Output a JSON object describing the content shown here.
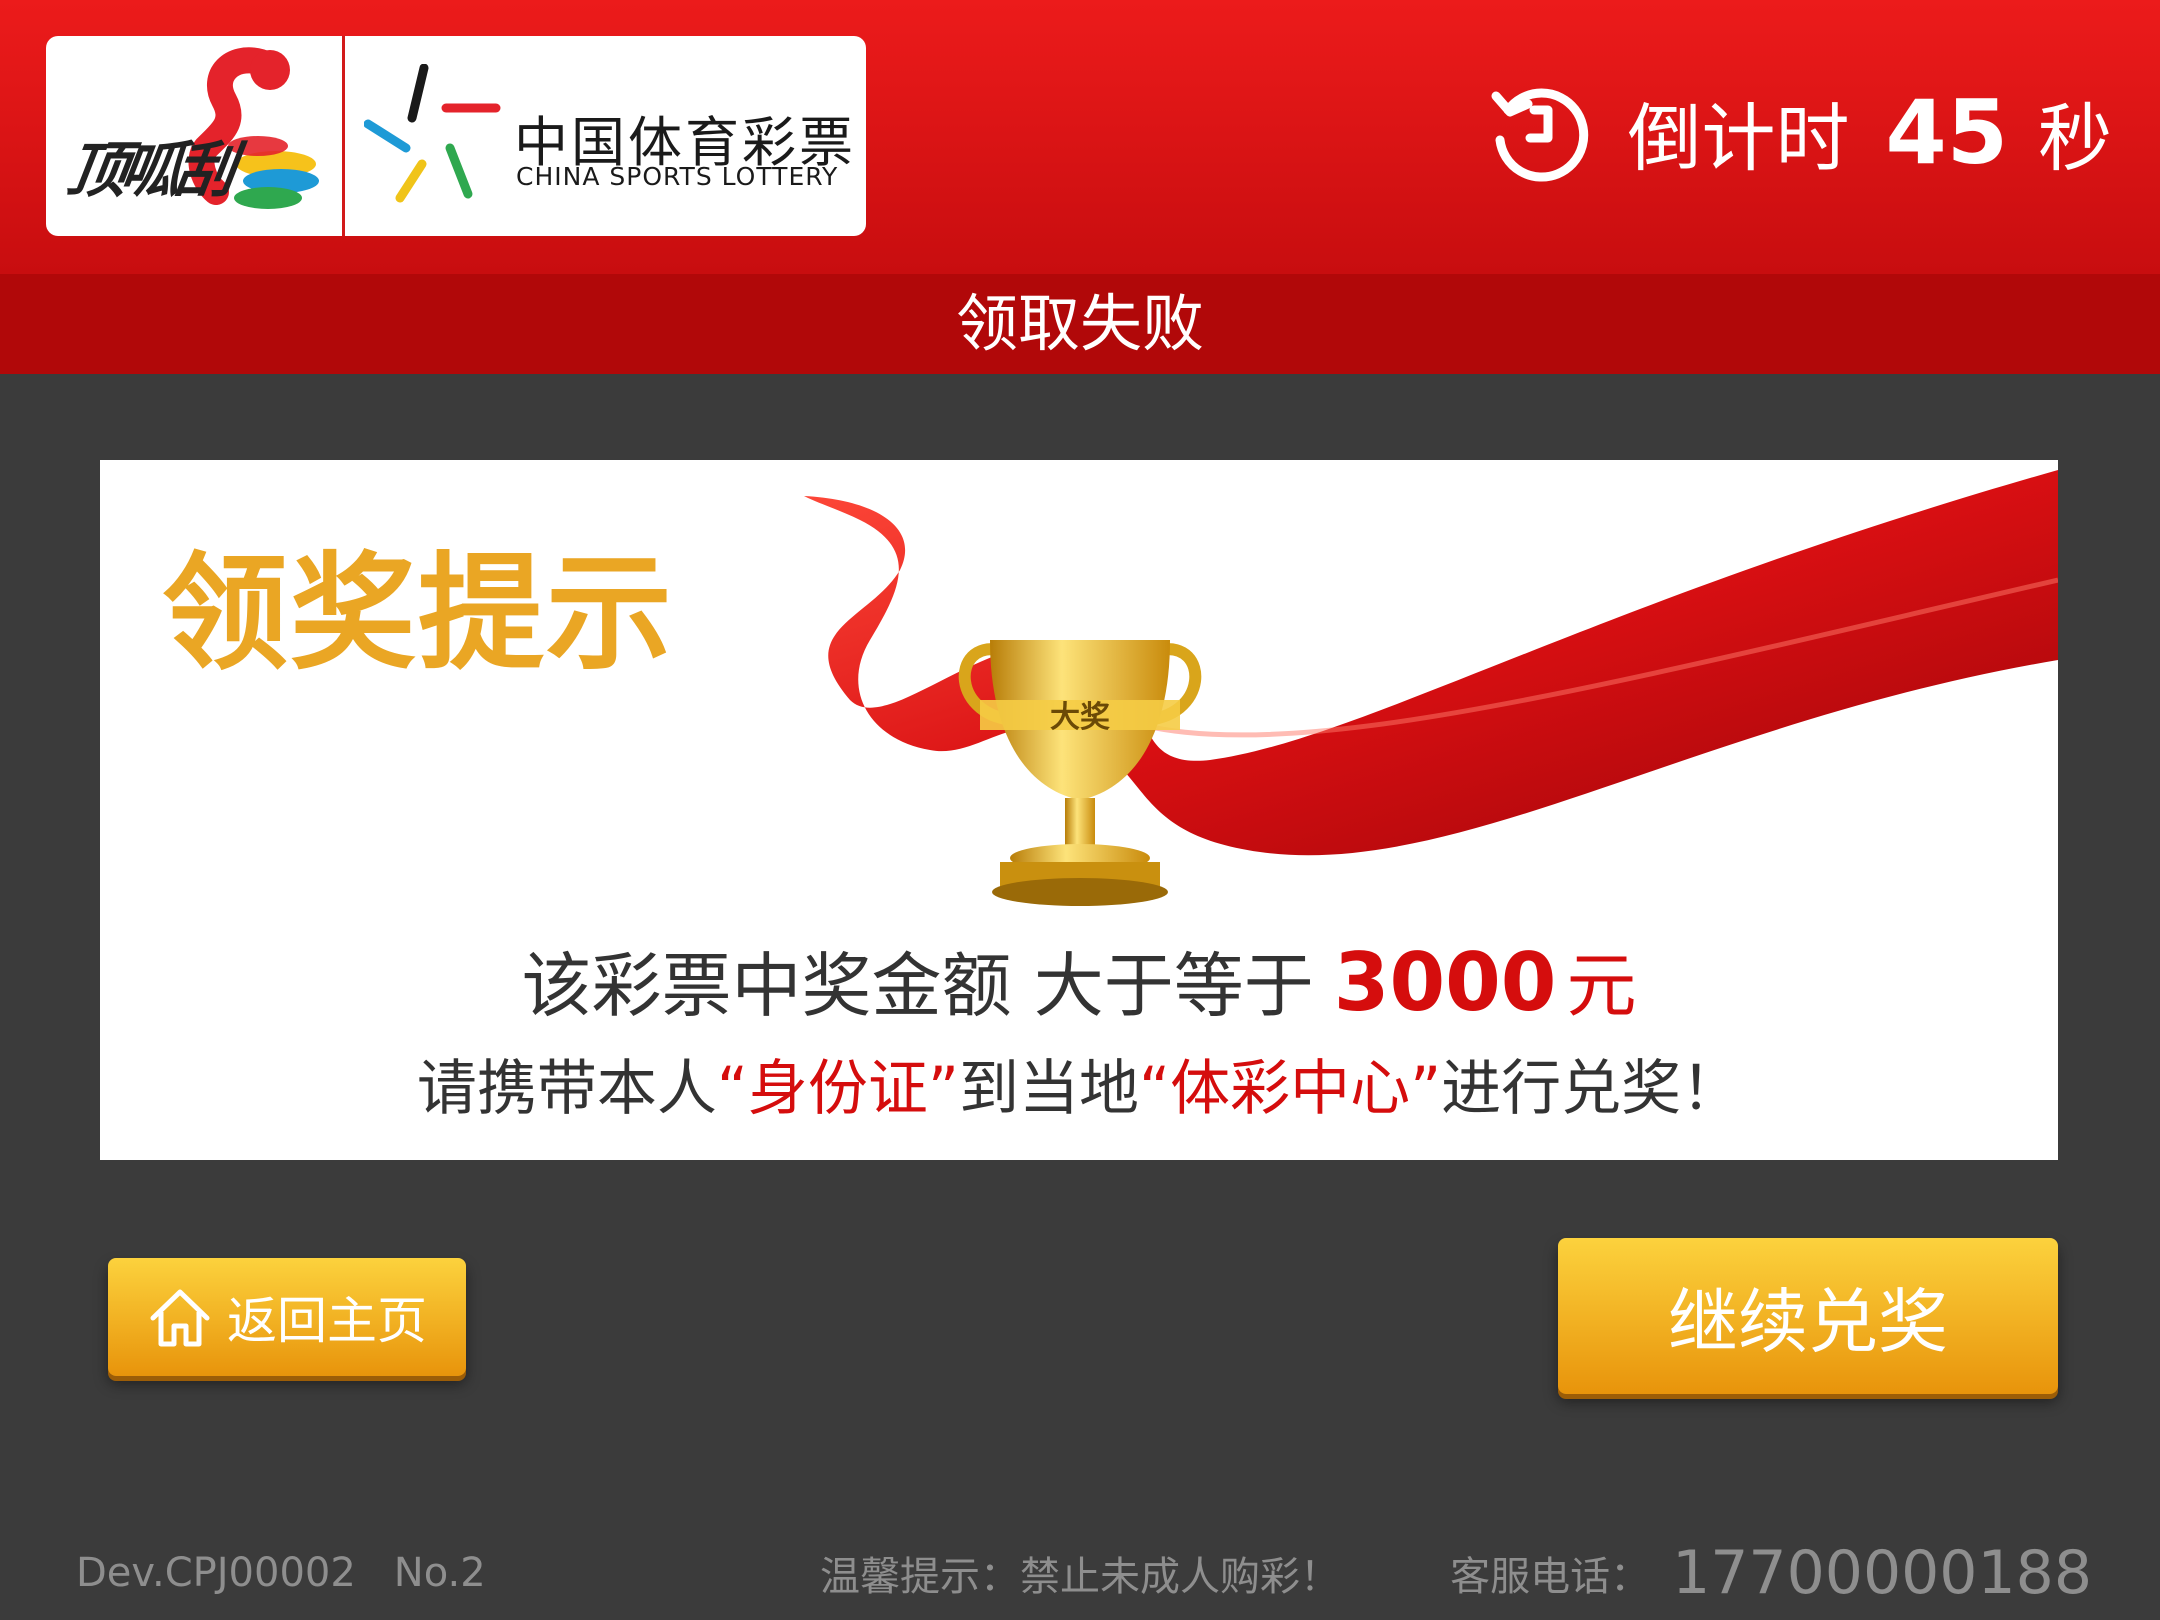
{
  "header": {
    "brand_logo_text": "顶呱刮",
    "lottery_name_cn": "中国体育彩票",
    "lottery_name_en": "CHINA SPORTS LOTTERY",
    "countdown_label": "倒计时",
    "countdown_value": "45",
    "countdown_unit": "秒"
  },
  "page_title": "领取失败",
  "panel": {
    "title": "领奖提示",
    "trophy_label": "大奖",
    "amount_text": "该彩票中奖金额 大于等于",
    "amount_value": "3000",
    "amount_unit": "元",
    "notice_prefix": "请携带本人",
    "notice_item1": "“身份证”",
    "notice_mid": "到当地",
    "notice_item2": "“体彩中心”",
    "notice_suffix": "进行兑奖！"
  },
  "buttons": {
    "home_label": "返回主页",
    "continue_label": "继续兑奖"
  },
  "footer": {
    "device": "Dev.CPJ00002",
    "number": "No.2",
    "tip": "温馨提示：禁止未成人购彩！",
    "phone_label": "客服电话：",
    "phone_value": "17700000188"
  },
  "colors": {
    "header_red": "#e41618",
    "title_bar_red": "#b10809",
    "background": "#3b3b3b",
    "accent_gold": "#eaa624",
    "highlight_red": "#d50d0d",
    "button_gold": "#f4b21f"
  },
  "icons": [
    "countdown-timer-icon",
    "home-icon",
    "trophy-icon",
    "lottery-star-logo-icon"
  ]
}
